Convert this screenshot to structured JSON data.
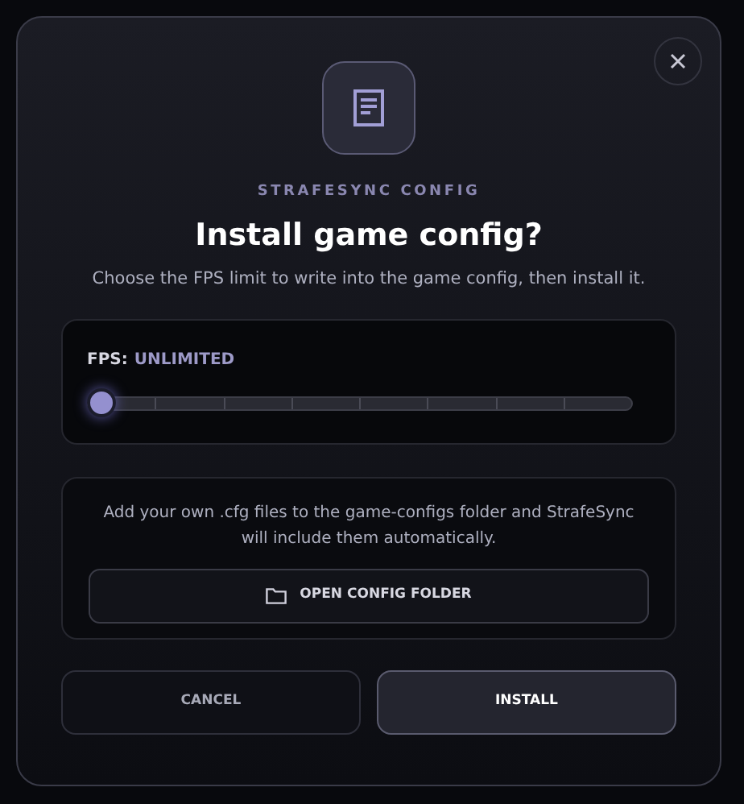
{
  "dialog": {
    "eyebrow": "STRAFESYNC CONFIG",
    "title": "Install game config?",
    "description": "Choose the FPS limit to write into the game config, then install it."
  },
  "fps": {
    "label": "FPS:",
    "value": "UNLIMITED",
    "level": 0
  },
  "folder_note": {
    "text": "Add your own .cfg files to the game-configs folder and StrafeSync will include them automatically.",
    "button": "OPEN CONFIG FOLDER"
  },
  "buttons": [
    {
      "label": "CANCEL",
      "kind": "secondary"
    },
    {
      "label": "INSTALL",
      "kind": "primary"
    }
  ]
}
